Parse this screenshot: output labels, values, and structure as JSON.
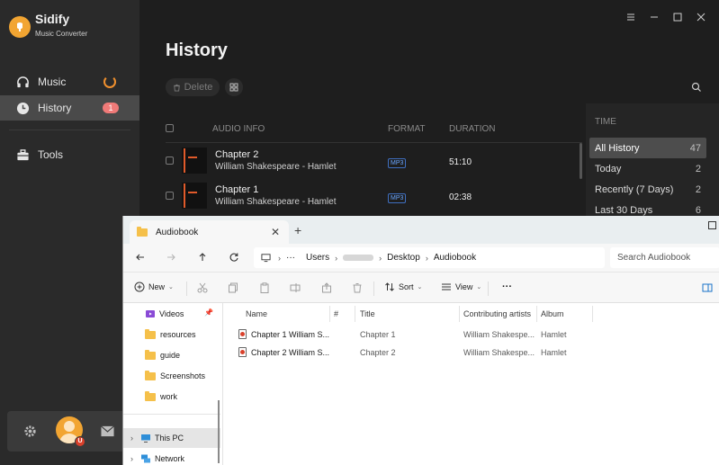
{
  "app": {
    "name": "Sidify",
    "subtitle": "Music Converter",
    "accent": "#f2a532"
  },
  "sidebar": {
    "items": [
      {
        "label": "Music",
        "icon": "headphones-icon"
      },
      {
        "label": "History",
        "icon": "clock-icon",
        "badge": "1"
      },
      {
        "label": "Tools",
        "icon": "toolbox-icon"
      }
    ],
    "bottom": {
      "settings_icon": "gear-icon",
      "avatar_badge": "U",
      "mail_icon": "mail-icon"
    }
  },
  "main": {
    "title": "History",
    "delete_label": "Delete",
    "list": {
      "headers": {
        "info": "AUDIO INFO",
        "format": "FORMAT",
        "duration": "DURATION"
      },
      "rows": [
        {
          "title": "Chapter 2",
          "artist": "William Shakespeare - Hamlet",
          "format": "MP3",
          "duration": "51:10"
        },
        {
          "title": "Chapter 1",
          "artist": "William Shakespeare - Hamlet",
          "format": "MP3",
          "duration": "02:38"
        }
      ]
    },
    "time_filter": {
      "header": "TIME",
      "items": [
        {
          "label": "All History",
          "count": "47"
        },
        {
          "label": "Today",
          "count": "2"
        },
        {
          "label": "Recently (7 Days)",
          "count": "2"
        },
        {
          "label": "Last 30 Days",
          "count": "6"
        }
      ]
    }
  },
  "explorer": {
    "tab_title": "Audiobook",
    "breadcrumbs": {
      "more": "···",
      "users": "Users",
      "desktop": "Desktop",
      "audiobook": "Audiobook"
    },
    "search_placeholder": "Search Audiobook",
    "toolbar": {
      "new_label": "New",
      "sort_label": "Sort",
      "view_label": "View",
      "more_label": "···"
    },
    "nav_items": [
      {
        "label": "Videos"
      },
      {
        "label": "resources"
      },
      {
        "label": "guide"
      },
      {
        "label": "Screenshots"
      },
      {
        "label": "work"
      },
      {
        "label": "This PC"
      },
      {
        "label": "Network"
      }
    ],
    "columns": {
      "name": "Name",
      "number": "#",
      "title": "Title",
      "artists": "Contributing artists",
      "album": "Album"
    },
    "files": [
      {
        "name": "Chapter 1 William S...",
        "title": "Chapter 1",
        "artists": "William Shakespe...",
        "album": "Hamlet"
      },
      {
        "name": "Chapter 2 William S...",
        "title": "Chapter 2",
        "artists": "William Shakespe...",
        "album": "Hamlet"
      }
    ]
  }
}
